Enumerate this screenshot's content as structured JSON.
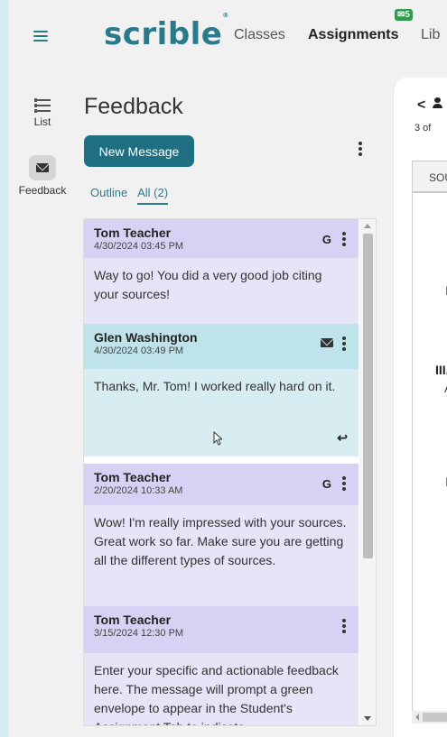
{
  "header": {
    "logo_text": "scrible",
    "logo_mark": "®",
    "nav": {
      "classes": "Classes",
      "assignments": "Assignments",
      "library": "Lib"
    },
    "assignments_badge": "5"
  },
  "rail": {
    "list_label": "List",
    "feedback_label": "Feedback"
  },
  "panel": {
    "title": "Feedback",
    "new_message_button": "New Message",
    "tabs": {
      "outline": "Outline",
      "all": "All (2)"
    }
  },
  "messages": [
    {
      "author": "Tom Teacher",
      "date": "4/30/2024 03:45 PM",
      "badge": "G",
      "body": "Way to go! You did a very good job citing your sources!"
    },
    {
      "author": "Glen Washington",
      "date": "4/30/2024 03:49 PM",
      "body": "Thanks, Mr. Tom! I worked really hard on it."
    },
    {
      "author": "Tom Teacher",
      "date": "2/20/2024 10:33 AM",
      "badge": "G",
      "body": "Wow! I'm really impressed with your sources. Great work so far. Make sure you are getting all the different types of sources."
    },
    {
      "author": "Tom Teacher",
      "date": "3/15/2024 12:30 PM",
      "body": "Enter your specific and actionable feedback here. The message will prompt a green envelope to appear in the Student's Assignment Tab to indicate"
    }
  ],
  "doc": {
    "back": "<",
    "count": "3 of",
    "tab": "SOU",
    "roman": "III.",
    "mark_a": "A",
    "mark_l": "I"
  },
  "colors": {
    "accent": "#2a7a8c",
    "button": "#1e6f82",
    "teacher_card": "#d6d2f3",
    "student_card": "#bfe3ea",
    "badge_green": "#2e9b4c"
  }
}
